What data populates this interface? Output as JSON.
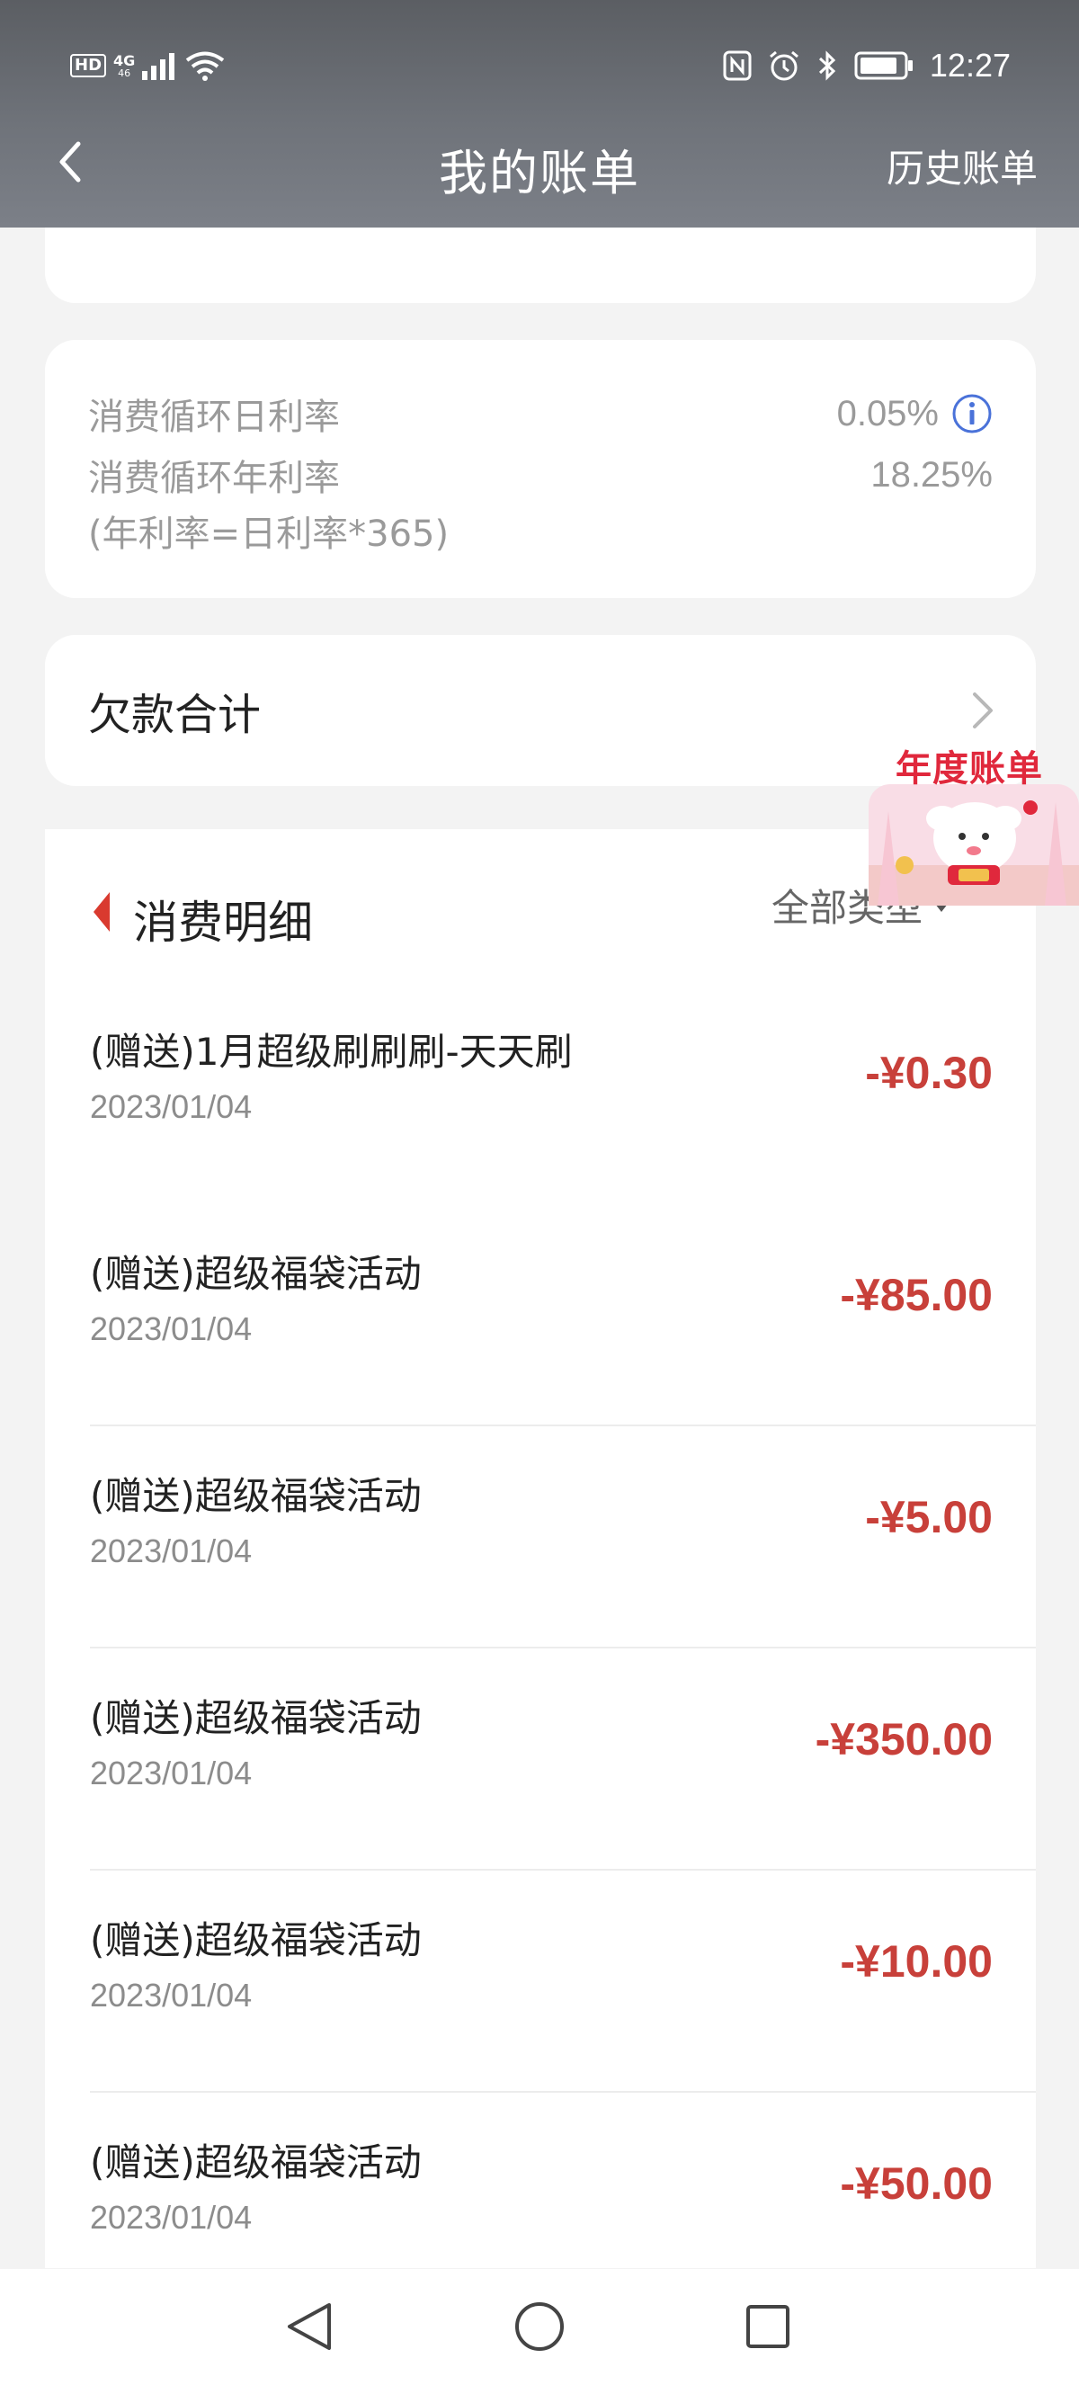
{
  "status_bar": {
    "hd_badge": "HD",
    "network": "4G",
    "signal_sub": "46",
    "time": "12:27",
    "icons": [
      "nfc-icon",
      "alarm-icon",
      "bluetooth-icon",
      "battery-icon"
    ]
  },
  "nav": {
    "title": "我的账单",
    "history_link": "历史账单"
  },
  "rates": {
    "daily_label": "消费循环日利率",
    "daily_value": "0.05%",
    "annual_label": "消费循环年利率",
    "annual_value": "18.25%",
    "formula_note": "(年利率=日利率*365)"
  },
  "debt": {
    "title": "欠款合计"
  },
  "promo": {
    "label": "年度账单"
  },
  "details": {
    "title": "消费明细",
    "filter_label": "全部类型",
    "transactions": [
      {
        "name": "(赠送)1月超级刷刷刷-天天刷",
        "date": "2023/01/04",
        "amount": "-¥0.30"
      },
      {
        "name": "(赠送)超级福袋活动",
        "date": "2023/01/04",
        "amount": "-¥85.00"
      },
      {
        "name": "(赠送)超级福袋活动",
        "date": "2023/01/04",
        "amount": "-¥5.00"
      },
      {
        "name": "(赠送)超级福袋活动",
        "date": "2023/01/04",
        "amount": "-¥350.00"
      },
      {
        "name": "(赠送)超级福袋活动",
        "date": "2023/01/04",
        "amount": "-¥10.00"
      },
      {
        "name": "(赠送)超级福袋活动",
        "date": "2023/01/04",
        "amount": "-¥50.00"
      }
    ]
  },
  "colors": {
    "header_bg": "#6a6e75",
    "amount_red": "#c8403a",
    "accent_red": "#d93a2f",
    "info_blue": "#4a72d9"
  }
}
